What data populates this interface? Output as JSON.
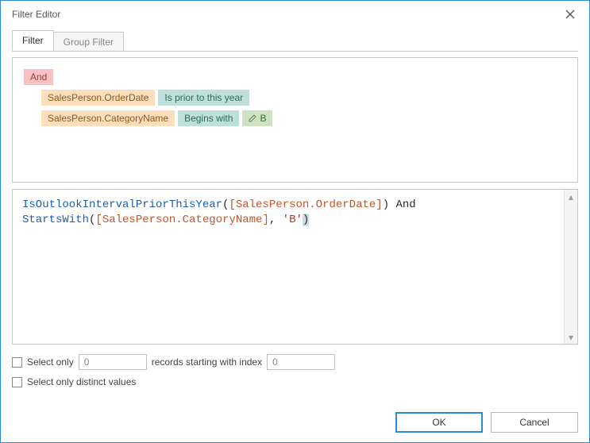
{
  "window": {
    "title": "Filter Editor"
  },
  "tabs": {
    "filter": "Filter",
    "group_filter": "Group Filter"
  },
  "rules": {
    "root_op": "And",
    "row1": {
      "field": "SalesPerson.OrderDate",
      "op": "Is prior to this year"
    },
    "row2": {
      "field": "SalesPerson.CategoryName",
      "op": "Begins with",
      "value": "B"
    }
  },
  "expression": {
    "func1": "IsOutlookIntervalPriorThisYear",
    "open1": "(",
    "field1": "[SalesPerson.OrderDate]",
    "close1": ")",
    "kw_and": " And ",
    "func2": "StartsWith",
    "open2": "(",
    "field2": "[SalesPerson.CategoryName]",
    "comma": ", ",
    "str": "'B'",
    "close2": ")"
  },
  "options": {
    "select_only_label": "Select only",
    "count_value": "0",
    "records_label": "records starting with index",
    "index_value": "0",
    "distinct_label": "Select only distinct values"
  },
  "buttons": {
    "ok": "OK",
    "cancel": "Cancel"
  }
}
